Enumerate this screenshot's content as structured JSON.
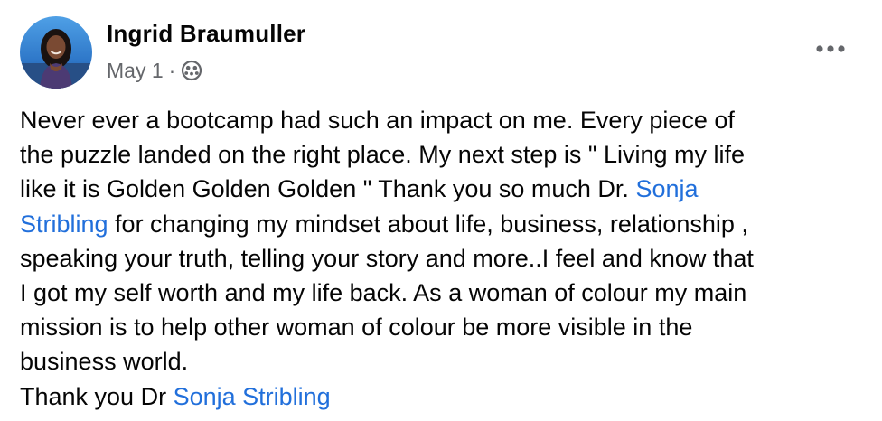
{
  "author": {
    "name": "Ingrid Braumuller",
    "avatar_icon": "profile-photo"
  },
  "meta": {
    "date": "May 1",
    "separator": "·",
    "audience_icon": "friends-icon"
  },
  "menu": {
    "icon": "more-horizontal-icon"
  },
  "post": {
    "lines": [
      {
        "a": "Never ever a bootcamp had such an impact on me. Every piece of"
      },
      {
        "a": "the puzzle landed on the right place. My next step is \" Living my life"
      },
      {
        "a": "like it is Golden Golden Golden \" Thank you so much Dr. ",
        "mention": "Sonja"
      },
      {
        "mention": "Stribling",
        "b": " for changing my mindset about life, business, relationship ,"
      },
      {
        "a": "speaking your truth, telling your story and more..I feel and know that"
      },
      {
        "a": "I got my self worth and my life back. As a woman of colour my main"
      },
      {
        "a": "mission is to help other woman of colour be more visible in the"
      },
      {
        "a": "business world."
      },
      {
        "a": "Thank you Dr ",
        "mention": "Sonja Stribling"
      }
    ]
  },
  "colors": {
    "mention": "#216fdb",
    "secondary_text": "#65676b",
    "primary_text": "#050505"
  }
}
